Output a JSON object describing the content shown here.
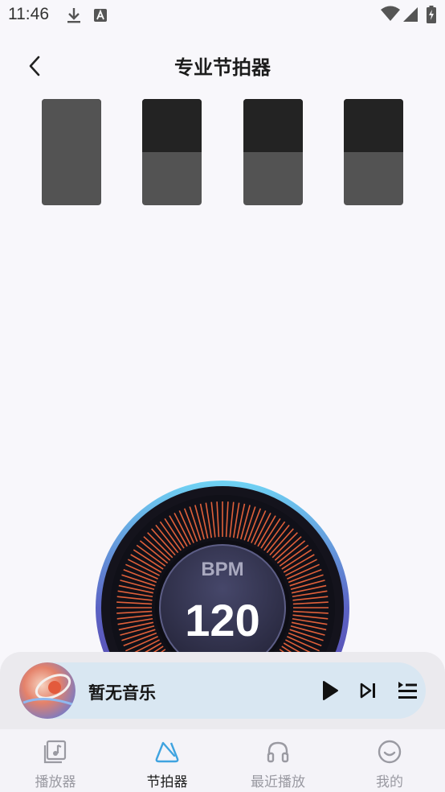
{
  "status_bar": {
    "time": "11:46",
    "icons": [
      "download-icon",
      "a-notification-icon",
      "wifi-icon",
      "signal-icon",
      "battery-icon"
    ]
  },
  "header": {
    "title": "专业节拍器",
    "back_icon": "chevron-left-icon"
  },
  "beats": [
    {
      "accent": true
    },
    {
      "accent": false
    },
    {
      "accent": false
    },
    {
      "accent": false
    }
  ],
  "metronome": {
    "label": "BPM",
    "value": "120"
  },
  "player": {
    "track_title": "暂无音乐",
    "controls": [
      "play-icon",
      "skip-next-icon",
      "playlist-icon"
    ]
  },
  "nav": {
    "items": [
      {
        "label": "播放器",
        "icon": "music-library-icon",
        "active": false
      },
      {
        "label": "节拍器",
        "icon": "metronome-icon",
        "active": true
      },
      {
        "label": "最近播放",
        "icon": "headphones-icon",
        "active": false
      },
      {
        "label": "我的",
        "icon": "smiley-icon",
        "active": false
      }
    ]
  },
  "colors": {
    "background": "#f8f7fb",
    "beat_dark": "#232323",
    "beat_light": "#535353",
    "active_nav": "#3fa3e0",
    "dial_ticks": "#e0603a",
    "player_bar": "#d9e7f2"
  }
}
